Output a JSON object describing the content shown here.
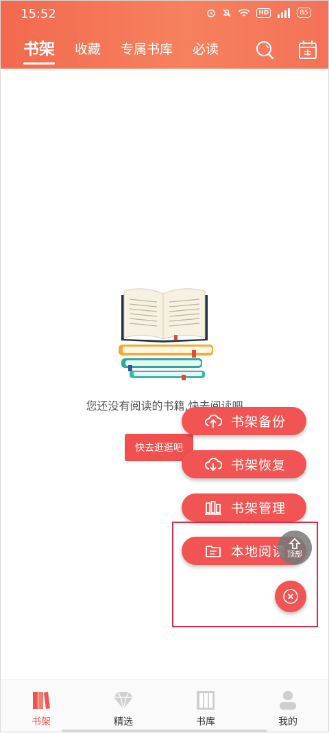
{
  "status_bar": {
    "time": "15:52",
    "network_badge": "HD",
    "battery": "85"
  },
  "header": {
    "tabs": [
      {
        "label": "书架",
        "active": true
      },
      {
        "label": "收藏",
        "active": false
      },
      {
        "label": "专属书库",
        "active": false
      },
      {
        "label": "必读",
        "active": false
      }
    ],
    "icons": [
      "search-icon",
      "calendar-sign-in-icon"
    ]
  },
  "empty_state": {
    "message": "您还没有阅读的书籍,快去阅读吧",
    "browse_button": "快去逛逛吧"
  },
  "fab_menu": {
    "items": [
      {
        "label": "书架备份",
        "icon": "cloud-upload-icon"
      },
      {
        "label": "书架恢复",
        "icon": "cloud-download-icon"
      },
      {
        "label": "书架管理",
        "icon": "bars-manage-icon"
      },
      {
        "label": "本地阅读",
        "icon": "folder-icon"
      }
    ],
    "top_button": "顶部",
    "close_icon": "close-icon"
  },
  "bottom_nav": [
    {
      "label": "书架",
      "active": true,
      "icon": "bookshelf-icon"
    },
    {
      "label": "精选",
      "active": false,
      "icon": "diamond-icon"
    },
    {
      "label": "书库",
      "active": false,
      "icon": "library-icon"
    },
    {
      "label": "我的",
      "active": false,
      "icon": "profile-icon"
    }
  ],
  "colors": {
    "header": "#f3694e",
    "accent": "#f25353",
    "highlight": "#d72c46"
  }
}
